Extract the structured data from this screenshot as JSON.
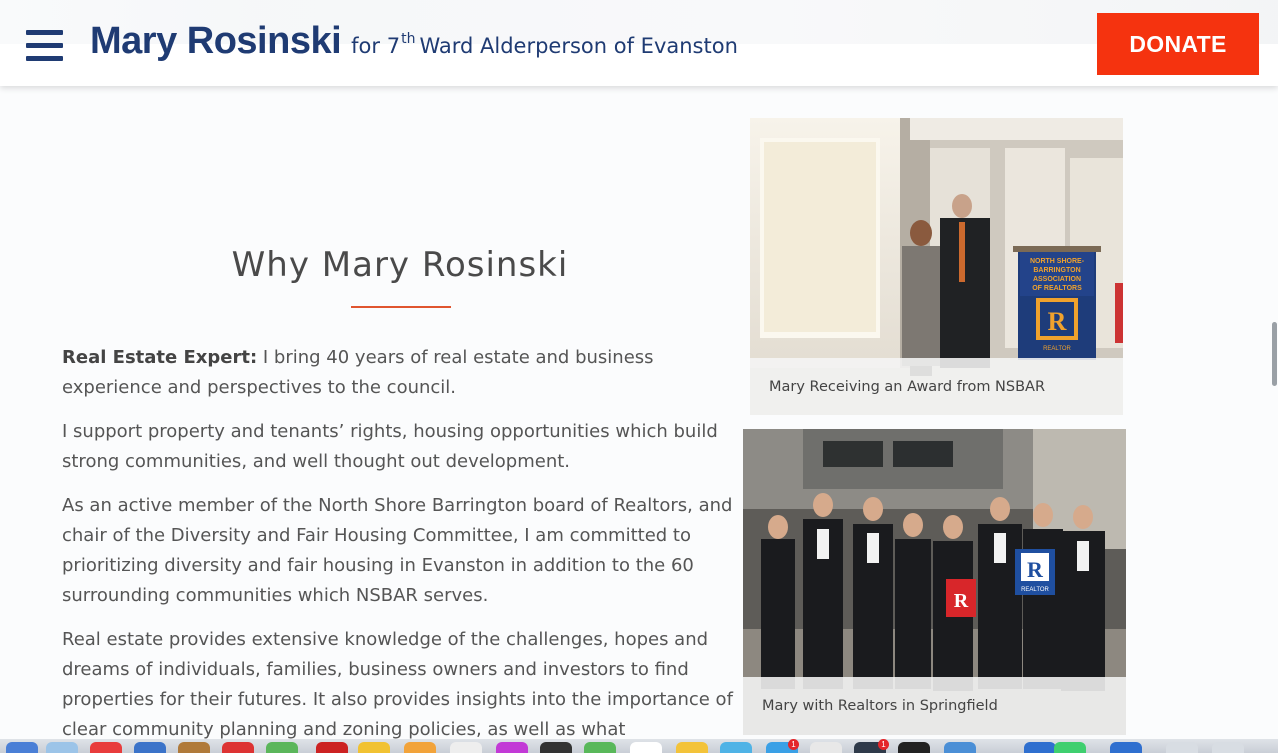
{
  "header": {
    "menu_icon": "hamburger-menu-icon",
    "name": "Mary Rosinski",
    "tagline_prefix": "for 7",
    "tagline_sup": "th",
    "tagline_suffix": "Ward Alderperson of Evanston",
    "donate_label": "DONATE",
    "colors": {
      "brand": "#1f3b73",
      "donate": "#f5330f"
    }
  },
  "main": {
    "title": "Why Mary Rosinski",
    "accent_color": "#e0552f",
    "paragraphs": [
      {
        "lead": "Real Estate Expert:",
        "text": " I bring 40 years of real estate and business experience and perspectives to the council."
      },
      {
        "lead": "",
        "text": "I support property and tenants’ rights, housing opportunities which build strong communities, and well thought out development."
      },
      {
        "lead": "",
        "text": "As an active member of the North Shore Barrington board of Realtors, and chair of the Diversity and Fair Housing Committee, I am committed to prioritizing diversity and fair housing in Evanston in addition to the 60 surrounding communities which NSBAR serves."
      },
      {
        "lead": "",
        "text": "Real estate provides extensive knowledge of the challenges, hopes and dreams of individuals, families, business owners and investors to find properties for their futures. It also provides insights into the importance of clear community planning and zoning policies, as well as what communities need to have in order"
      }
    ]
  },
  "photos": [
    {
      "caption": "Mary Receiving an Award from NSBAR",
      "podium_text": "NORTH SHORE-BARRINGTON ASSOCIATION OF REALTORS",
      "logo_letter": "R",
      "logo_word": "REALTOR"
    },
    {
      "caption": "Mary with Realtors in Springfield",
      "sign_letter": "R",
      "sign_word": "REALTOR"
    }
  ],
  "dock": {
    "badges": [
      "1",
      "1"
    ]
  }
}
